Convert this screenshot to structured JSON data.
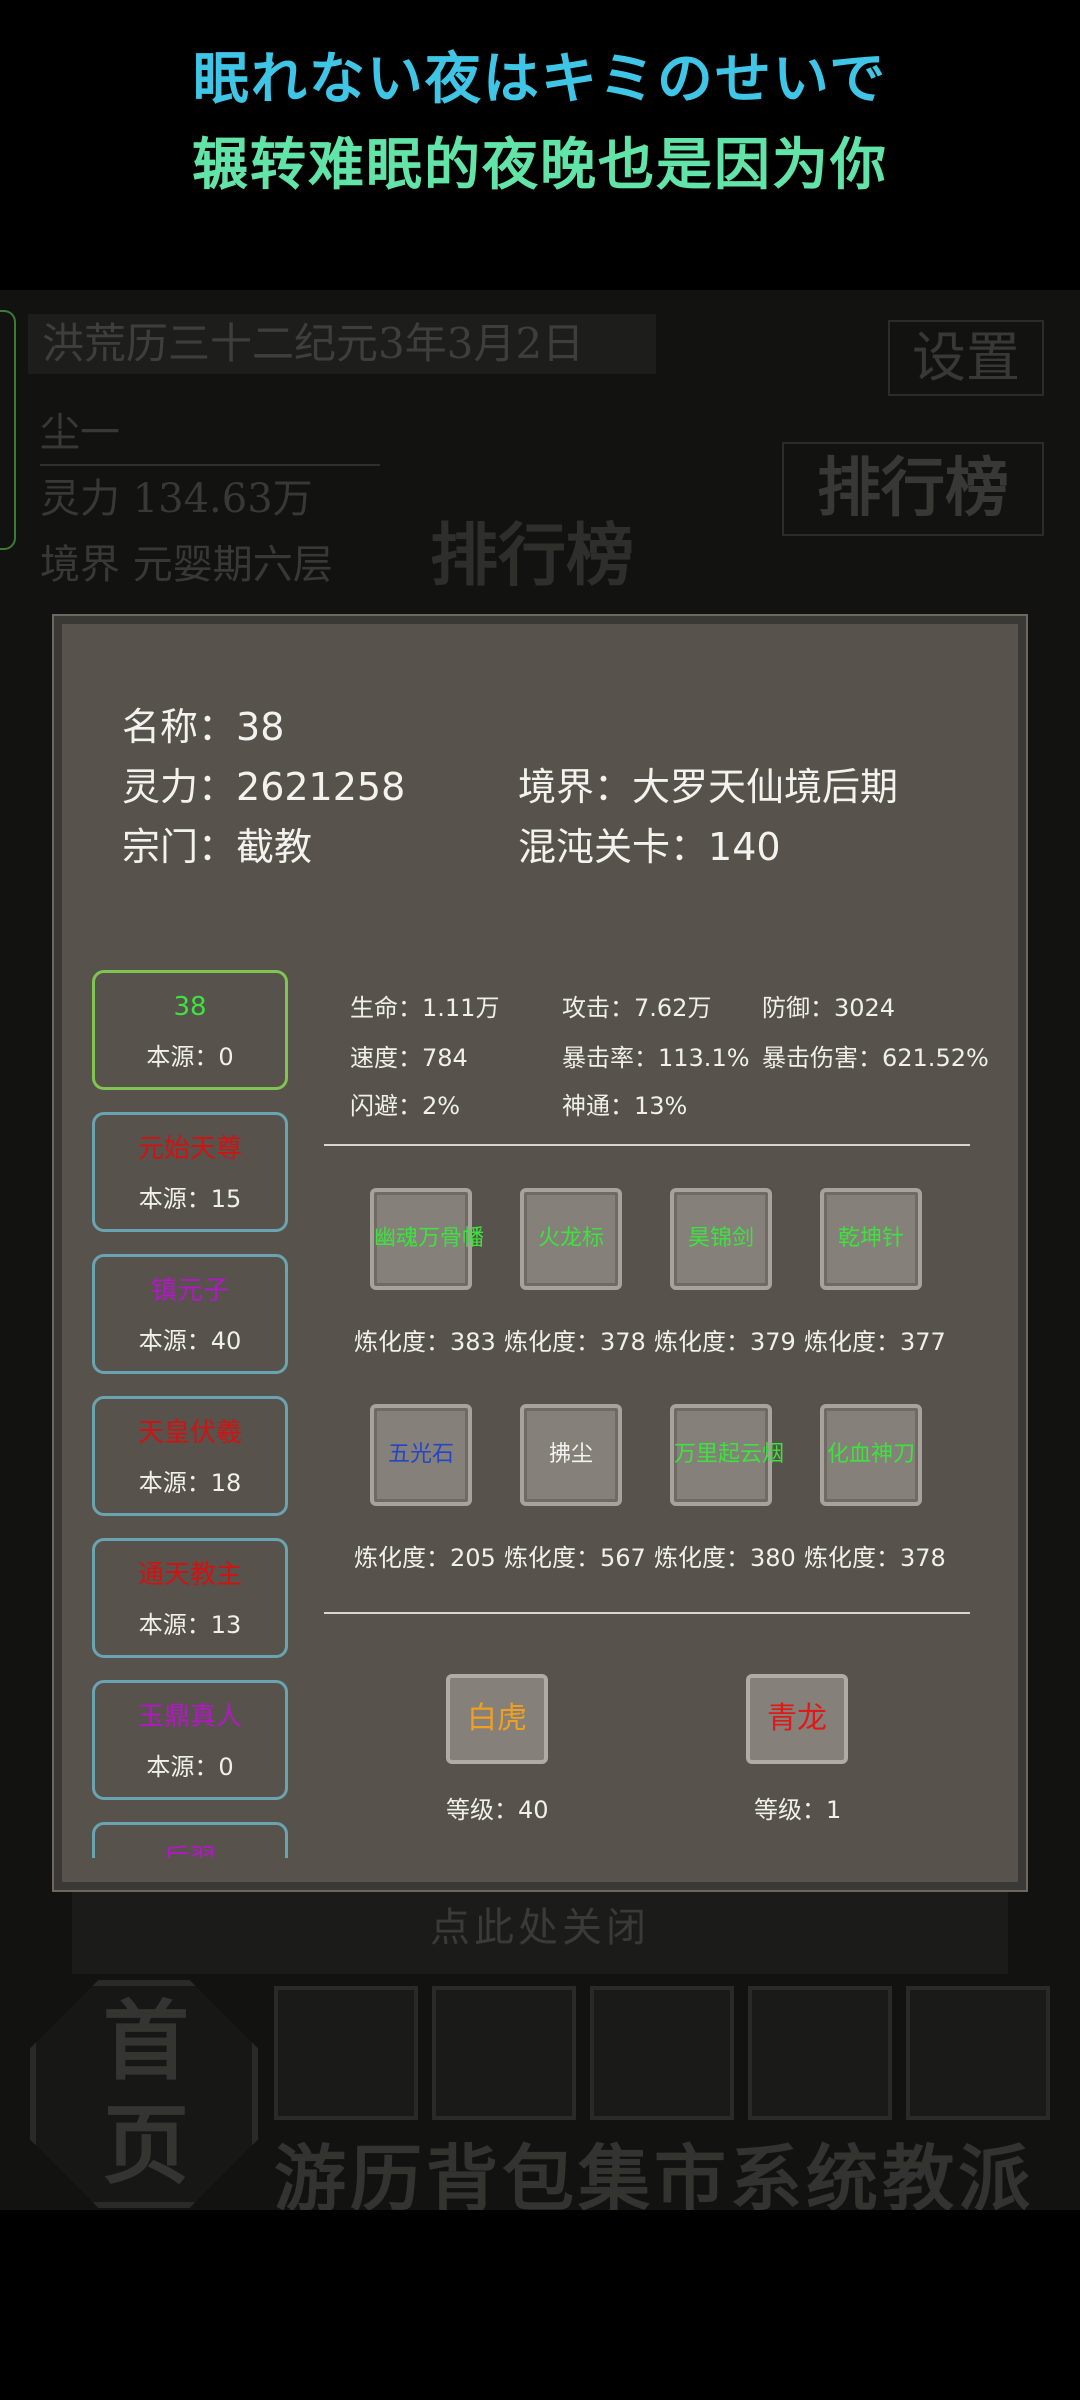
{
  "lyrics": {
    "line1": "眠れない夜はキミのせいで",
    "line2": "辗转难眠的夜晚也是因为你"
  },
  "background": {
    "date": "洪荒历三十二纪元3年3月2日",
    "settings": "设置",
    "leaderboard_button": "排行榜",
    "player_name": "尘一",
    "lingli": "灵力  134.63万",
    "jingjie": "境界  元婴期六层",
    "leaderboard_title": "排行榜",
    "close_hint": "点此处关闭",
    "home": "首页",
    "nav": [
      "游历",
      "背包",
      "集市",
      "系统",
      "教派"
    ]
  },
  "modal": {
    "name_label": "名称",
    "name_value": "38",
    "lingli_label": "灵力",
    "lingli_value": "2621258",
    "realm_label": "境界",
    "realm_value": "大罗天仙境后期",
    "sect_label": "宗门",
    "sect_value": "截教",
    "stage_label": "混沌关卡",
    "stage_value": "140",
    "source_label": "本源",
    "characters": [
      {
        "name": "38",
        "source": "0",
        "color": "#3ee23e"
      },
      {
        "name": "元始天尊",
        "source": "15",
        "color": "#d21212"
      },
      {
        "name": "镇元子",
        "source": "40",
        "color": "#b516c8"
      },
      {
        "name": "天皇伏羲",
        "source": "18",
        "color": "#d21212"
      },
      {
        "name": "通天教主",
        "source": "13",
        "color": "#d21212"
      },
      {
        "name": "玉鼎真人",
        "source": "0",
        "color": "#b516c8"
      },
      {
        "name": "后羿",
        "source": "",
        "color": "#b516c8"
      }
    ],
    "stats": {
      "hp": {
        "label": "生命",
        "value": "1.11万"
      },
      "atk": {
        "label": "攻击",
        "value": "7.62万"
      },
      "def": {
        "label": "防御",
        "value": "3024"
      },
      "spd": {
        "label": "速度",
        "value": "784"
      },
      "crit": {
        "label": "暴击率",
        "value": "113.1%"
      },
      "critdmg": {
        "label": "暴击伤害",
        "value": "621.52%"
      },
      "dodge": {
        "label": "闪避",
        "value": "2%"
      },
      "power": {
        "label": "神通",
        "value": "13%"
      }
    },
    "refine_label": "炼化度",
    "treasures": [
      {
        "name": "幽魂万骨幡",
        "level": "383",
        "color": "#3ee23e"
      },
      {
        "name": "火龙标",
        "level": "378",
        "color": "#3ee23e"
      },
      {
        "name": "昊锦剑",
        "level": "379",
        "color": "#3ee23e"
      },
      {
        "name": "乾坤针",
        "level": "377",
        "color": "#3ee23e"
      },
      {
        "name": "五光石",
        "level": "205",
        "color": "#2346c8"
      },
      {
        "name": "拂尘",
        "level": "567",
        "color": "#f4f2ee"
      },
      {
        "name": "万里起云烟",
        "level": "380",
        "color": "#3ee23e"
      },
      {
        "name": "化血神刀",
        "level": "378",
        "color": "#3ee23e"
      }
    ],
    "grade_label": "等级",
    "beasts": [
      {
        "name": "白虎",
        "level": "40",
        "color": "#f0a020"
      },
      {
        "name": "青龙",
        "level": "1",
        "color": "#e01818"
      }
    ]
  }
}
